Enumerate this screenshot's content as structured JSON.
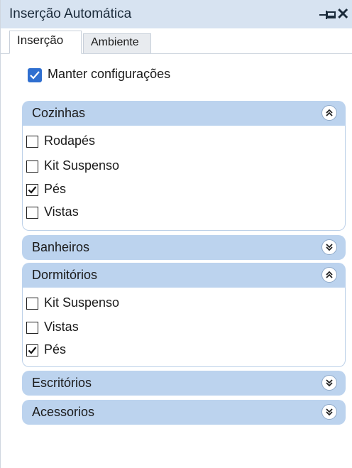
{
  "window": {
    "title": "Inserção Automática",
    "close_glyph": "✕"
  },
  "tabs": [
    {
      "label": "Inserção",
      "active": true
    },
    {
      "label": "Ambiente",
      "active": false
    }
  ],
  "keep_settings": {
    "label": "Manter configurações",
    "checked": true
  },
  "sections": {
    "cozinhas": {
      "label": "Cozinhas",
      "expanded": true,
      "items": [
        {
          "label": "Rodapés",
          "checked": false
        },
        {
          "label": "Kit Suspenso",
          "checked": false
        },
        {
          "label": "Pés",
          "checked": true
        },
        {
          "label": "Vistas",
          "checked": false
        }
      ]
    },
    "banheiros": {
      "label": "Banheiros",
      "expanded": false
    },
    "dormitorios": {
      "label": "Dormitórios",
      "expanded": true,
      "items": [
        {
          "label": "Kit Suspenso",
          "checked": false
        },
        {
          "label": "Vistas",
          "checked": false
        },
        {
          "label": "Pés",
          "checked": true
        }
      ]
    },
    "escritorios": {
      "label": "Escritórios",
      "expanded": false
    },
    "acessorios": {
      "label": "Acessorios",
      "expanded": false
    }
  },
  "colors": {
    "title_bar": "#d7e3f1",
    "section_header": "#bcd3ee",
    "accent_checkbox": "#2f6fd0"
  },
  "icons": {
    "pin": "pin-icon",
    "close": "close-icon",
    "collapse": "chevron-double-up-icon",
    "expand": "chevron-double-down-icon",
    "check": "check-icon"
  }
}
